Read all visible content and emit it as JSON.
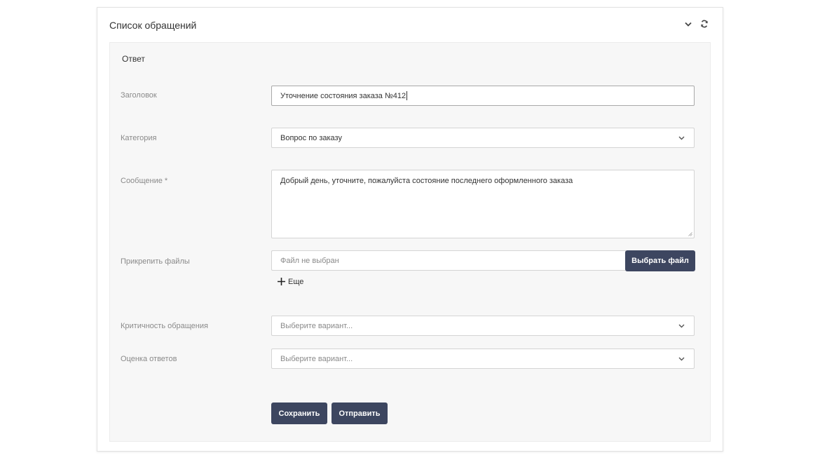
{
  "panel": {
    "title": "Список обращений",
    "collapse_icon": "chevron-down-icon",
    "refresh_icon": "refresh-icon"
  },
  "form": {
    "section_title": "Ответ",
    "subject": {
      "label": "Заголовок",
      "value": "Уточнение состояния заказа №412"
    },
    "category": {
      "label": "Категория",
      "value": "Вопрос по заказу"
    },
    "message": {
      "label": "Сообщение *",
      "value": "Добрый день, уточните, пожалуйста состояние последнего оформленного заказа"
    },
    "attachments": {
      "label": "Прикрепить файлы",
      "placeholder": "Файл не выбран",
      "choose_button": "Выбрать файл",
      "add_more": "Еще"
    },
    "criticality": {
      "label": "Критичность обращения",
      "placeholder": "Выберите вариант..."
    },
    "rating": {
      "label": "Оценка ответов",
      "placeholder": "Выберите вариант..."
    },
    "save_button": "Сохранить",
    "send_button": "Отправить"
  },
  "colors": {
    "button_bg": "#3d4660",
    "panel_bg": "#f7f7f7",
    "label": "#8a8a8a"
  }
}
